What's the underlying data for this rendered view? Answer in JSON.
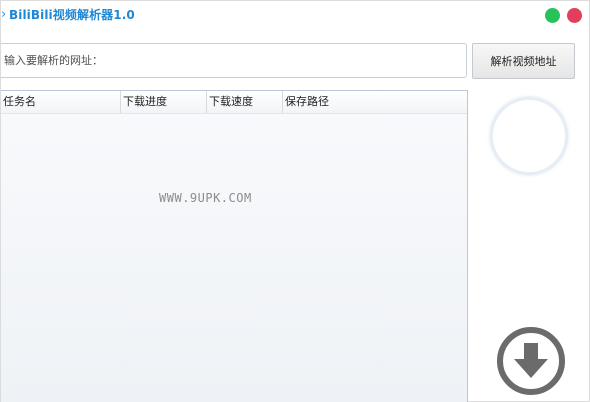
{
  "window": {
    "title": "BiliBili视频解析器1.0",
    "controls": [
      "green-dot",
      "red-dot"
    ]
  },
  "url_bar": {
    "placeholder": "输入要解析的网址：",
    "value": "",
    "parse_button_label": "解析视频地址"
  },
  "task_table": {
    "columns": [
      "任务名",
      "下载进度",
      "下载速度",
      "保存路径"
    ],
    "rows": [],
    "watermark": "WWW.9UPK.COM"
  },
  "colors": {
    "title_blue": "#1f88d6",
    "green_button": "#27c25a",
    "red_button": "#e33e5c",
    "download_icon": "#6b6b6b"
  },
  "icons": {
    "chevron": "chevron-right-icon",
    "download": "download-arrow-icon"
  }
}
